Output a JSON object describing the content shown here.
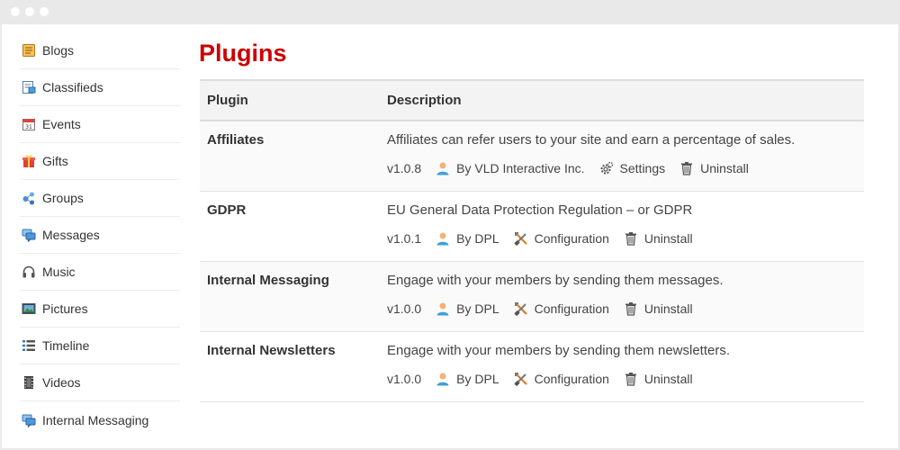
{
  "sidebar": {
    "items": [
      {
        "label": "Blogs",
        "icon": "blog-icon"
      },
      {
        "label": "Classifieds",
        "icon": "classifieds-icon"
      },
      {
        "label": "Events",
        "icon": "calendar-icon"
      },
      {
        "label": "Gifts",
        "icon": "gift-icon"
      },
      {
        "label": "Groups",
        "icon": "groups-icon"
      },
      {
        "label": "Messages",
        "icon": "messages-icon"
      },
      {
        "label": "Music",
        "icon": "headphones-icon"
      },
      {
        "label": "Pictures",
        "icon": "picture-icon"
      },
      {
        "label": "Timeline",
        "icon": "timeline-icon"
      },
      {
        "label": "Videos",
        "icon": "film-icon"
      },
      {
        "label": "Internal Messaging",
        "icon": "messages-icon"
      }
    ]
  },
  "page": {
    "title": "Plugins",
    "title_color": "#cc0000"
  },
  "table": {
    "headers": {
      "plugin": "Plugin",
      "description": "Description"
    },
    "rows": [
      {
        "name": "Affiliates",
        "description": "Affiliates can refer users to your site and earn a percentage of sales.",
        "version": "v1.0.8",
        "author": "By VLD Interactive Inc.",
        "action": "Settings",
        "action_icon": "gear-icon",
        "uninstall": "Uninstall"
      },
      {
        "name": "GDPR",
        "description": "EU General Data Protection Regulation – or GDPR",
        "version": "v1.0.1",
        "author": "By DPL",
        "action": "Configuration",
        "action_icon": "tools-icon",
        "uninstall": "Uninstall"
      },
      {
        "name": "Internal Messaging",
        "description": "Engage with your members by sending them messages.",
        "version": "v1.0.0",
        "author": "By DPL",
        "action": "Configuration",
        "action_icon": "tools-icon",
        "uninstall": "Uninstall"
      },
      {
        "name": "Internal Newsletters",
        "description": "Engage with your members by sending them newsletters.",
        "version": "v1.0.0",
        "author": "By DPL",
        "action": "Configuration",
        "action_icon": "tools-icon",
        "uninstall": "Uninstall"
      }
    ]
  }
}
